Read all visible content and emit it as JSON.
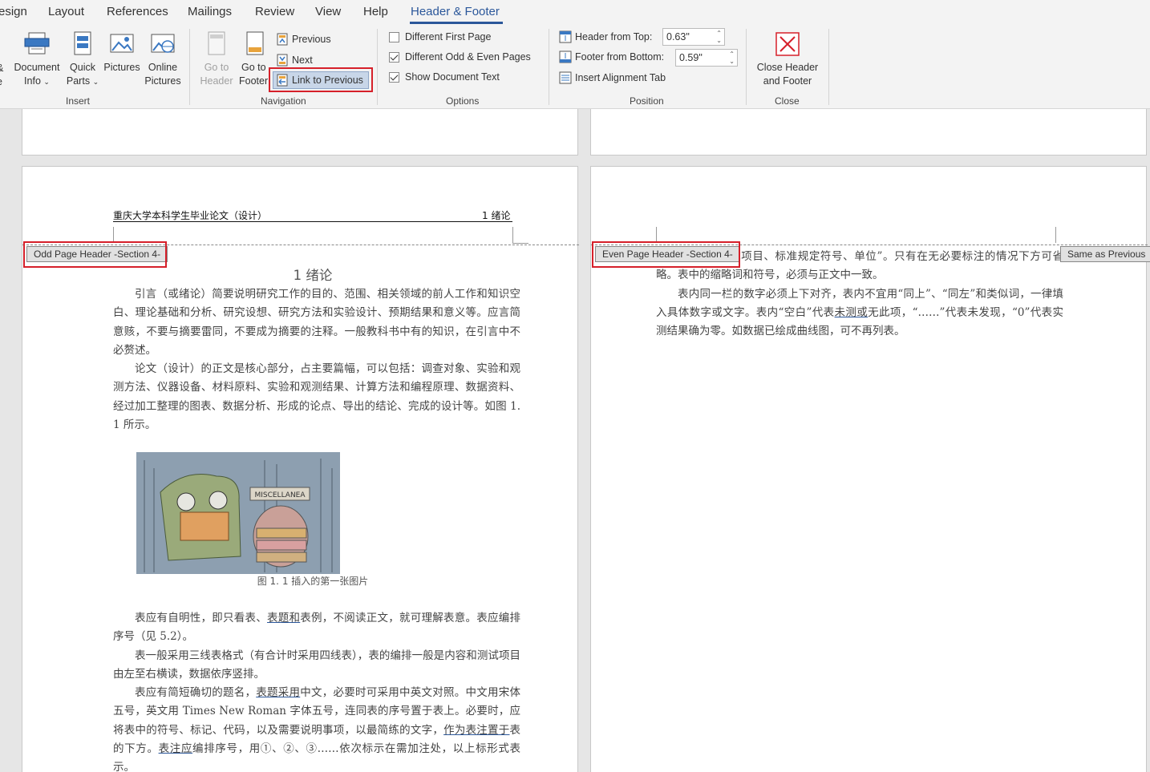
{
  "tabs": [
    "esign",
    "Layout",
    "References",
    "Mailings",
    "Review",
    "View",
    "Help",
    "Header & Footer"
  ],
  "ribbon": {
    "insert": {
      "cut_label": "&",
      "cut_label2": "e",
      "document_info": [
        "Document",
        "Info"
      ],
      "quick_parts": [
        "Quick",
        "Parts"
      ],
      "pictures": "Pictures",
      "online_pictures": [
        "Online",
        "Pictures"
      ],
      "group": "Insert"
    },
    "navigation": {
      "go_to_header": [
        "Go to",
        "Header"
      ],
      "go_to_footer": [
        "Go to",
        "Footer"
      ],
      "previous": "Previous",
      "next": "Next",
      "link_to_previous": "Link to Previous",
      "group": "Navigation"
    },
    "options": {
      "different_first_page": "Different First Page",
      "different_odd_even": "Different Odd & Even Pages",
      "show_document_text": "Show Document Text",
      "group": "Options"
    },
    "position": {
      "header_from_top_label": "Header from Top:",
      "header_from_top_value": "0.63\"",
      "footer_from_bottom_label": "Footer from Bottom:",
      "footer_from_bottom_value": "0.59\"",
      "insert_alignment_tab": "Insert Alignment Tab",
      "group": "Position"
    },
    "close": {
      "close_label": [
        "Close Header",
        "and Footer"
      ],
      "group": "Close"
    }
  },
  "odd_page": {
    "header_left": "重庆大学本科学生毕业论文（设计）",
    "header_right": "1 绪论",
    "tag": "Odd Page Header -Section 4-",
    "chapter_title": "1 绪论",
    "paragraphs": [
      "引言（或绪论）简要说明研究工作的目的、范围、相关领域的前人工作和知识空白、理论基础和分析、研究设想、研究方法和实验设计、预期结果和意义等。应言简意赅，不要与摘要雷同，不要成为摘要的注释。一般教科书中有的知识，在引言中不必赘述。",
      "论文（设计）的正文是核心部分，占主要篇幅，可以包括：调查对象、实验和观测方法、仪器设备、材料原料、实验和观测结果、计算方法和编程原理、数据资料、经过加工整理的图表、数据分析、形成的论点、导出的结论、完成的设计等。如图 1. 1 所示。"
    ],
    "figure_caption": "图 1. 1 插入的第一张图片",
    "figure_sign": "MISCELLANEA",
    "para3_a": "表应有自明性，即只看表、",
    "para3_link": "表题和",
    "para3_b": "表例，不阅读正文，就可理解表意。表应编排序号（见 5.2）。",
    "para4": "表一般采用三线表格式（有合计时采用四线表），表的编排一般是内容和测试项目由左至右横读，数据依序竖排。",
    "para5_a": "表应有简短确切的题名，",
    "para5_link1": "表题采用",
    "para5_b": "中文，必要时可采用中英文对照。中文用宋体五号，英文用 Times New Roman 字体五号，连同表的序号置于表上。必要时，应将表中的符号、标记、代码，以及需要说明事项，以最简练的文字，",
    "para5_link2": "作为表注置于",
    "para5_c": "表的下方。",
    "para5_link3": "表注应",
    "para5_d": "编排序号，用①、②、③……依次标示在需加注处，以上标形式表示。"
  },
  "even_page": {
    "tag": "Even Page Header -Section 4-",
    "same_as_previous": "Same as Previous",
    "line1": "应标明“量或测试项目、标准规定符号、单位”。只有在无必要标注的情况下方可省略。表中的缩略词和符号，必须与正文中一致。",
    "para2_a": "表内同一栏的数字必须上下对齐，表内不宜用“同上”、“同左”和类似词，一律填入具体数字或文字。表内“空白”代表",
    "para2_link": "未测或",
    "para2_b": "无此项，“……”代表未发现，“0”代表实测结果确为零。如数据已绘成曲线图，可不再列表。"
  }
}
